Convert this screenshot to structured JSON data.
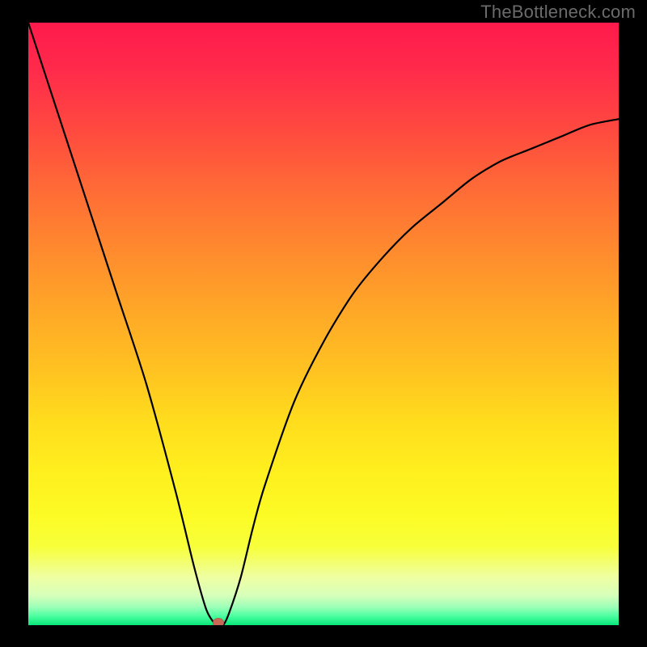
{
  "watermark": "TheBottleneck.com",
  "chart_data": {
    "type": "line",
    "title": "",
    "xlabel": "",
    "ylabel": "",
    "xlim": [
      0,
      100
    ],
    "ylim": [
      0,
      100
    ],
    "grid": false,
    "legend": false,
    "background_gradient": {
      "top": "#ff1a4c",
      "mid": "#ffd21f",
      "bottom": "#08e67a",
      "description": "vertical red-to-yellow-to-green gradient"
    },
    "series": [
      {
        "name": "bottleneck-curve",
        "color": "#000000",
        "x": [
          0,
          5,
          10,
          15,
          20,
          25,
          28,
          30,
          31,
          32,
          33,
          34,
          36,
          38,
          40,
          45,
          50,
          55,
          60,
          65,
          70,
          75,
          80,
          85,
          90,
          95,
          100
        ],
        "values": [
          100,
          85,
          70,
          55,
          40,
          22,
          10,
          3,
          1,
          0,
          0,
          2,
          8,
          16,
          23,
          37,
          47,
          55,
          61,
          66,
          70,
          74,
          77,
          79,
          81,
          83,
          84
        ]
      }
    ],
    "marker": {
      "x": 32.2,
      "y": 0,
      "color": "#c96857"
    }
  }
}
